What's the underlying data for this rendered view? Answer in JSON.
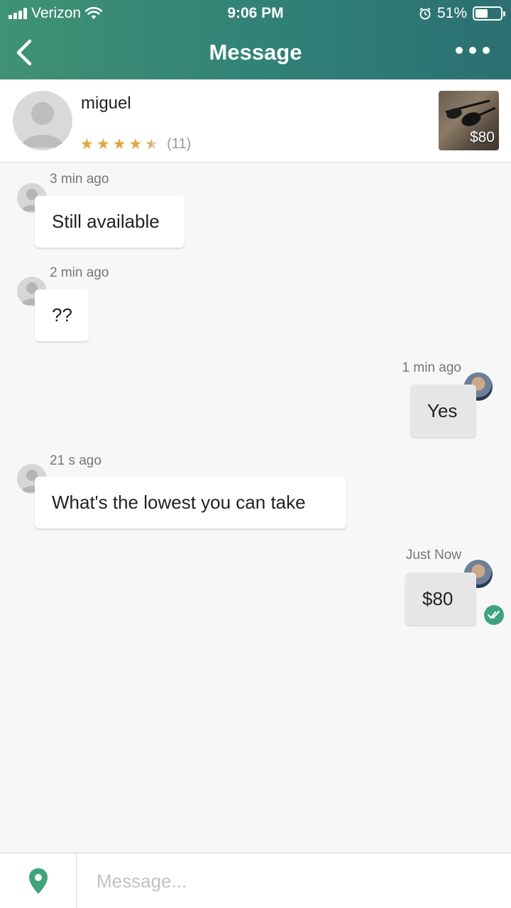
{
  "status_bar": {
    "carrier": "Verizon",
    "time": "9:06 PM",
    "battery": "51%",
    "battery_level": 0.51
  },
  "nav": {
    "title": "Message"
  },
  "seller": {
    "name": "miguel",
    "rating": 4.5,
    "rating_count": "(11)",
    "product_price": "$80"
  },
  "messages": [
    {
      "time": "3 min ago",
      "text": "Still available",
      "sender": "them"
    },
    {
      "time": "2 min ago",
      "text": "??",
      "sender": "them"
    },
    {
      "time": "1 min ago",
      "text": "Yes",
      "sender": "me"
    },
    {
      "time": "21 s ago",
      "text": "What's the lowest you can take",
      "sender": "them"
    },
    {
      "time": "Just Now",
      "text": "$80",
      "sender": "me",
      "read": true
    }
  ],
  "composer": {
    "placeholder": "Message..."
  },
  "colors": {
    "header": "#3f9273",
    "accent": "#3fa37b",
    "star": "#e8a33d"
  }
}
